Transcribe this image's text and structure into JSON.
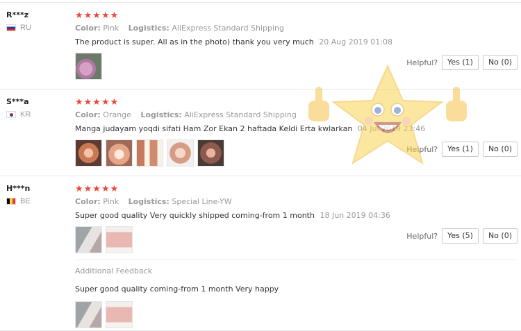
{
  "reviews": [
    {
      "user": "R***z",
      "country": "RU",
      "stars": "★★★★★",
      "color_label": "Color:",
      "color_value": "Pink",
      "logistics_label": "Logistics:",
      "logistics_value": "AliExpress Standard Shipping",
      "text": "The product is super. All as in the photo) thank you very much",
      "date": "20 Aug 2019 01:08",
      "helpful_label": "Helpful?",
      "yes_label": "Yes (1)",
      "no_label": "No (0)"
    },
    {
      "user": "S***a",
      "country": "KR",
      "stars": "★★★★★",
      "color_label": "Color:",
      "color_value": "Orange",
      "logistics_label": "Logistics:",
      "logistics_value": "AliExpress Standard Shipping",
      "text": "Manga judayam yoqdi sifati Ham Zor Ekan 2 haftada Keldi Erta kwlarkan",
      "date": "04 Jul 2019 23:46",
      "helpful_label": "Helpful?",
      "yes_label": "Yes (1)",
      "no_label": "No (0)"
    },
    {
      "user": "H***n",
      "country": "BE",
      "stars": "★★★★★",
      "color_label": "Color:",
      "color_value": "Pink",
      "logistics_label": "Logistics:",
      "logistics_value": "Special Line-YW",
      "text": "Super good quality Very quickly shipped coming-from 1 month",
      "date": "18 Jun 2019 04:36",
      "helpful_label": "Helpful?",
      "yes_label": "Yes (5)",
      "no_label": "No (0)",
      "additional_feedback_title": "Additional Feedback",
      "additional_feedback_text": "Super good quality coming-from 1 month Very happy"
    }
  ],
  "colors": {
    "star": "#e9473b",
    "meta_text": "#999999",
    "border": "#c9c9c9"
  }
}
